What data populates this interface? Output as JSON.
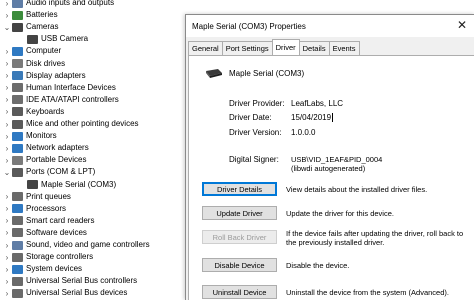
{
  "tree": {
    "items": [
      {
        "label": "Audio inputs and outputs",
        "chevron": "›",
        "icon": "speaker-icon",
        "color": "#5f7da6"
      },
      {
        "label": "Batteries",
        "chevron": "›",
        "icon": "battery-icon",
        "color": "#3c8c3c"
      },
      {
        "label": "Cameras",
        "chevron": "⌄",
        "icon": "camera-icon",
        "color": "#444444"
      },
      {
        "label": "USB Camera",
        "chevron": "",
        "icon": "camera-icon",
        "color": "#444444",
        "indent": true
      },
      {
        "label": "Computer",
        "chevron": "›",
        "icon": "monitor-icon",
        "color": "#2f79c2"
      },
      {
        "label": "Disk drives",
        "chevron": "›",
        "icon": "disk-icon",
        "color": "#7a7a7a"
      },
      {
        "label": "Display adapters",
        "chevron": "›",
        "icon": "display-adapter-icon",
        "color": "#3a7ab8"
      },
      {
        "label": "Human Interface Devices",
        "chevron": "›",
        "icon": "hid-icon",
        "color": "#6c6c6c"
      },
      {
        "label": "IDE ATA/ATAPI controllers",
        "chevron": "›",
        "icon": "controller-icon",
        "color": "#6d6d6d"
      },
      {
        "label": "Keyboards",
        "chevron": "›",
        "icon": "keyboard-icon",
        "color": "#5a5a5a"
      },
      {
        "label": "Mice and other pointing devices",
        "chevron": "›",
        "icon": "mouse-icon",
        "color": "#5a5a5a"
      },
      {
        "label": "Monitors",
        "chevron": "›",
        "icon": "monitor-icon",
        "color": "#2f79c2"
      },
      {
        "label": "Network adapters",
        "chevron": "›",
        "icon": "network-icon",
        "color": "#2f79c2"
      },
      {
        "label": "Portable Devices",
        "chevron": "›",
        "icon": "portable-device-icon",
        "color": "#7a7a7a"
      },
      {
        "label": "Ports (COM & LPT)",
        "chevron": "⌄",
        "icon": "port-icon",
        "color": "#5a5a5a"
      },
      {
        "label": "Maple Serial (COM3)",
        "chevron": "",
        "icon": "port-icon",
        "color": "#444444",
        "indent": true,
        "selected": true
      },
      {
        "label": "Print queues",
        "chevron": "›",
        "icon": "printer-icon",
        "color": "#6a6a6a"
      },
      {
        "label": "Processors",
        "chevron": "›",
        "icon": "processor-icon",
        "color": "#2f79c2"
      },
      {
        "label": "Smart card readers",
        "chevron": "›",
        "icon": "smart-card-icon",
        "color": "#6a6a6a"
      },
      {
        "label": "Software devices",
        "chevron": "›",
        "icon": "software-device-icon",
        "color": "#6a6a6a"
      },
      {
        "label": "Sound, video and game controllers",
        "chevron": "›",
        "icon": "sound-icon",
        "color": "#5f7da6"
      },
      {
        "label": "Storage controllers",
        "chevron": "›",
        "icon": "storage-icon",
        "color": "#6a6a6a"
      },
      {
        "label": "System devices",
        "chevron": "›",
        "icon": "system-device-icon",
        "color": "#2f79c2"
      },
      {
        "label": "Universal Serial Bus controllers",
        "chevron": "›",
        "icon": "usb-icon",
        "color": "#6a6a6a"
      },
      {
        "label": "Universal Serial Bus devices",
        "chevron": "›",
        "icon": "usb-icon",
        "color": "#6a6a6a"
      }
    ]
  },
  "dialog": {
    "title": "Maple Serial (COM3) Properties",
    "close_glyph": "✕",
    "tabs": [
      "General",
      "Port Settings",
      "Driver",
      "Details",
      "Events"
    ],
    "active_tab": "Driver",
    "device_name": "Maple Serial (COM3)",
    "props": {
      "provider_label": "Driver Provider:",
      "provider_value": "LeafLabs, LLC",
      "date_label": "Driver Date:",
      "date_value": "15/04/2019",
      "version_label": "Driver Version:",
      "version_value": "1.0.0.0",
      "signer_label": "Digital Signer:",
      "signer_value": "USB\\VID_1EAF&PID_0004 (libwdi autogenerated)"
    },
    "buttons": {
      "details_label": "Driver Details",
      "details_desc": "View details about the installed driver files.",
      "update_label": "Update Driver",
      "update_desc": "Update the driver for this device.",
      "rollback_label": "Roll Back Driver",
      "rollback_desc": "If the device fails after updating the driver, roll back to the previously installed driver.",
      "disable_label": "Disable Device",
      "disable_desc": "Disable the device.",
      "uninstall_label": "Uninstall Device",
      "uninstall_desc": "Uninstall the device from the system (Advanced)."
    }
  }
}
